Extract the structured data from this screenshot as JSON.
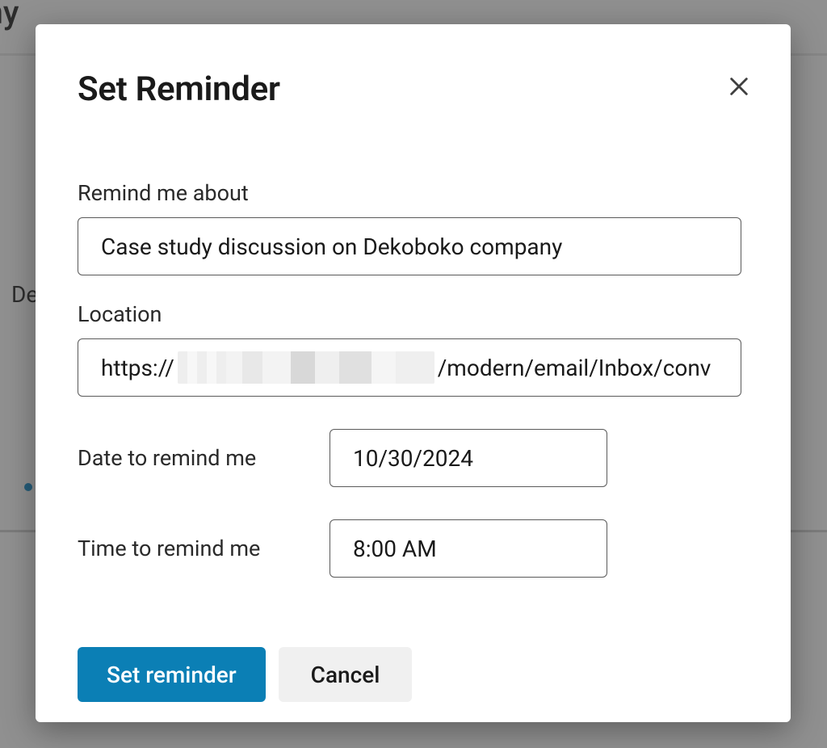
{
  "background": {
    "top_fragment": "any",
    "left_fragment": "De"
  },
  "modal": {
    "title": "Set Reminder",
    "close_icon_name": "close-icon",
    "fields": {
      "remind_about": {
        "label": "Remind me about",
        "value": "Case study discussion on Dekoboko company"
      },
      "location": {
        "label": "Location",
        "prefix": "https://",
        "suffix": "/modern/email/Inbox/conv"
      },
      "date": {
        "label": "Date to remind me",
        "value": "10/30/2024"
      },
      "time": {
        "label": "Time to remind me",
        "value": "8:00 AM"
      }
    },
    "buttons": {
      "primary": "Set reminder",
      "secondary": "Cancel"
    }
  }
}
